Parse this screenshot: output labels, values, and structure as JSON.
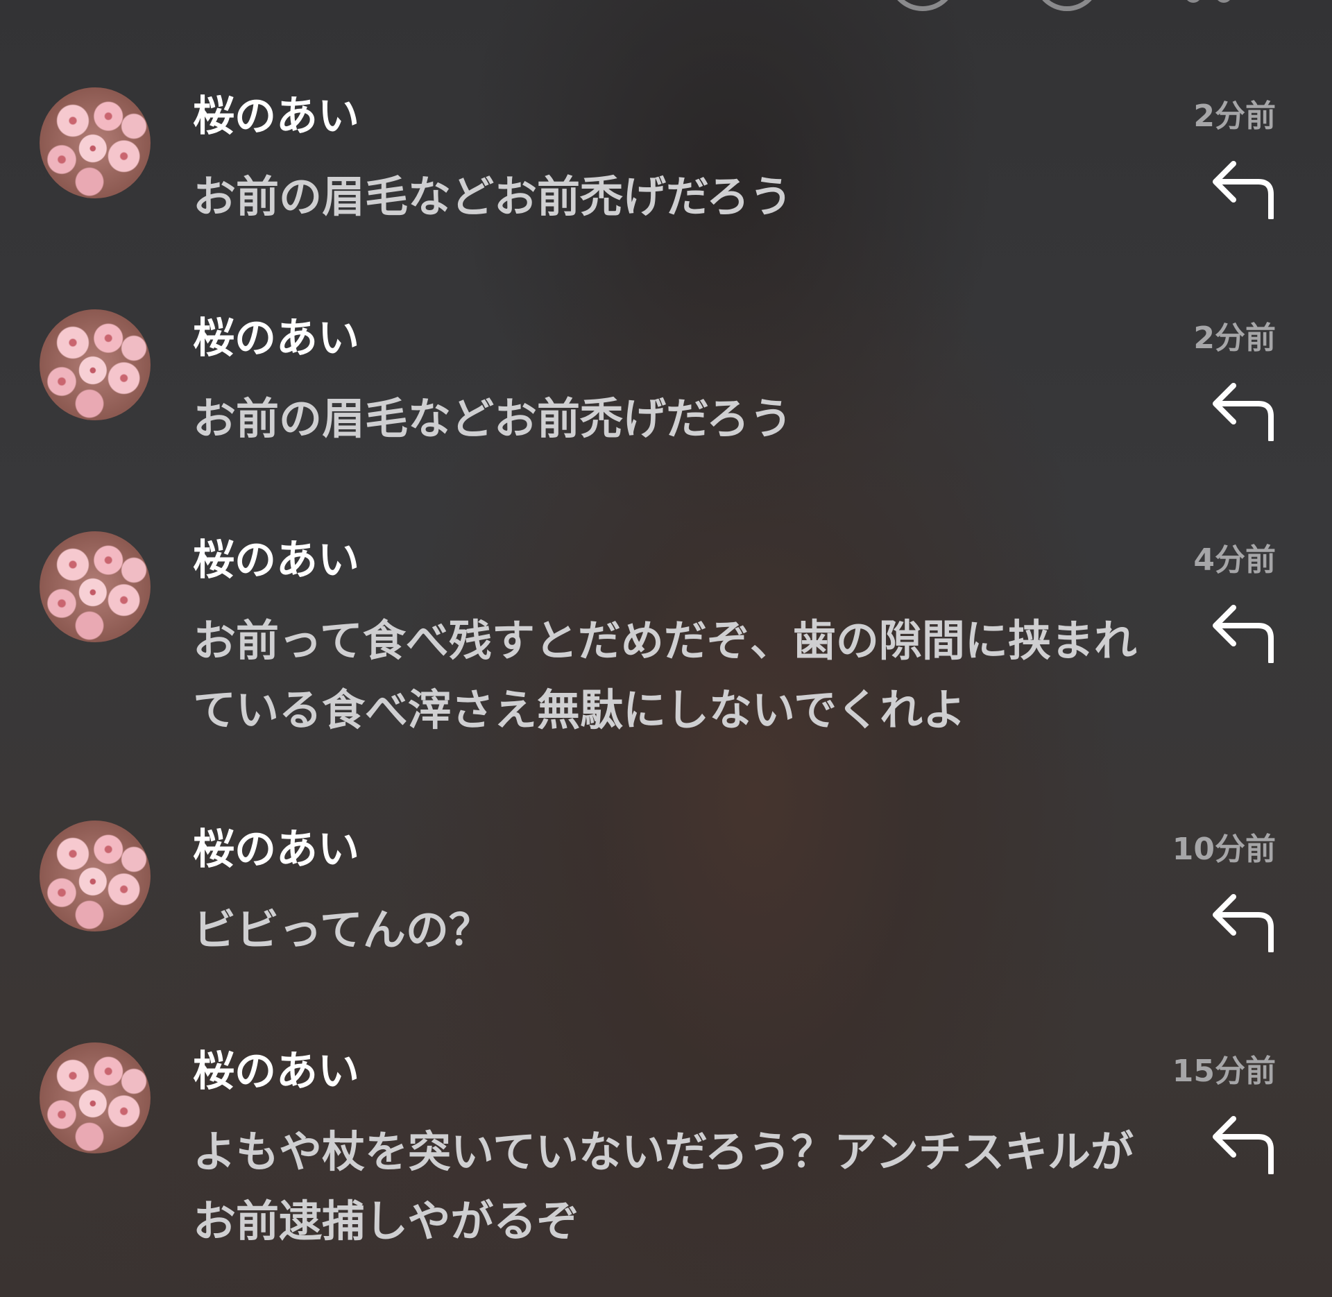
{
  "comments": [
    {
      "username": "桜のあい",
      "time": "2分前",
      "text": "お前の眉毛などお前禿げだろう",
      "reply_icon": "reply-arrow-icon"
    },
    {
      "username": "桜のあい",
      "time": "2分前",
      "text": "お前の眉毛などお前禿げだろう",
      "reply_icon": "reply-arrow-icon"
    },
    {
      "username": "桜のあい",
      "time": "4分前",
      "text": "お前って食べ残すとだめだぞ、歯の隙間に挟まれている食べ滓さえ無駄にしないでくれよ",
      "reply_icon": "reply-arrow-icon"
    },
    {
      "username": "桜のあい",
      "time": "10分前",
      "text": "ビビってんの？",
      "reply_icon": "reply-arrow-icon"
    },
    {
      "username": "桜のあい",
      "time": "15分前",
      "text": "よもや杖を突いていないだろう？アンチスキルがお前逮捕しやがるぞ",
      "reply_icon": "reply-arrow-icon"
    }
  ],
  "top_icons": [
    "comment-icon",
    "circle-icon",
    "more-dots-icon"
  ],
  "colors": {
    "username": "#ffffff",
    "message": "#cfcfd1",
    "timestamp": "#a6a6a8",
    "background": "#3a3a3c"
  }
}
